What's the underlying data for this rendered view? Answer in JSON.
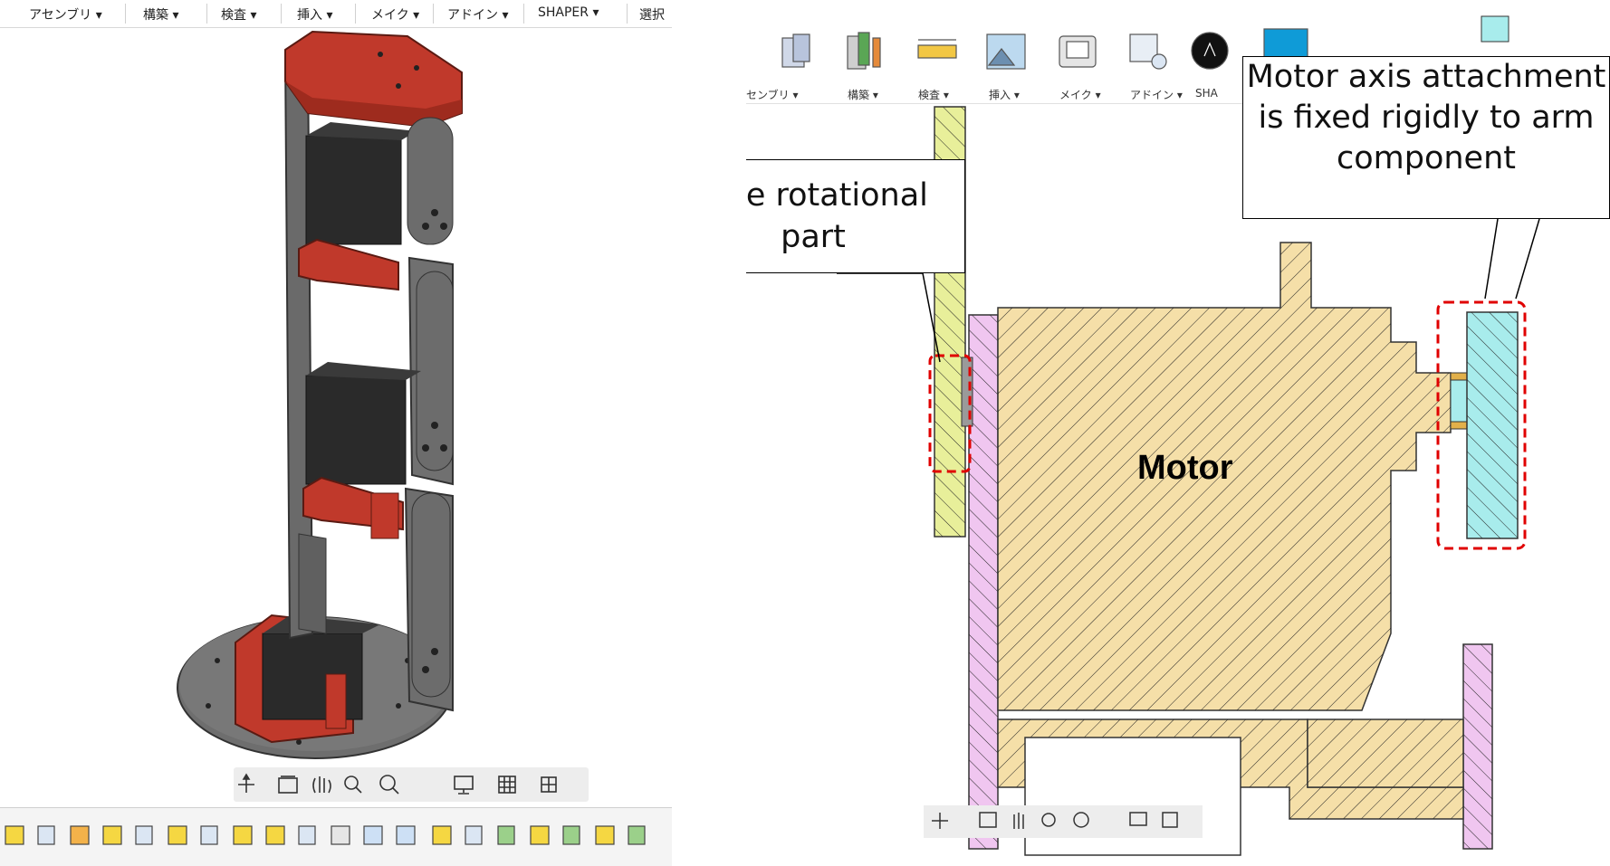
{
  "left_window": {
    "menu": [
      "アセンブリ ▾",
      "構築 ▾",
      "検査 ▾",
      "挿入 ▾",
      "メイク ▾",
      "アドイン ▾",
      "SHAPER ▾",
      "選択"
    ],
    "nav_bar_icons": [
      "orbit-icon",
      "look-at-icon",
      "pan-icon",
      "zoom-icon",
      "fit-icon",
      "display-settings-icon",
      "grid-icon",
      "viewports-icon"
    ]
  },
  "right_window": {
    "toolbar": [
      {
        "label": "センブリ ▾"
      },
      {
        "label": "構築 ▾"
      },
      {
        "label": "検査 ▾"
      },
      {
        "label": "挿入 ▾"
      },
      {
        "label": "メイク ▾"
      },
      {
        "label": "アドイン ▾"
      },
      {
        "label": "SHA"
      }
    ],
    "callouts": {
      "free_rotation": "Free rotational part",
      "axis_fixed": "Motor axis attachment is fixed rigidly to arm component"
    },
    "motor_label": "Motor"
  },
  "colors": {
    "robot_red": "#c0392b",
    "robot_dark": "#333333",
    "plate_gray": "#6e6e6e",
    "motor_fill": "#f5dfa8",
    "yellow_part": "#e8ef9a",
    "pink_part": "#f0c6f0",
    "cyan_part": "#a8ecec",
    "dash_red": "#e00000"
  }
}
